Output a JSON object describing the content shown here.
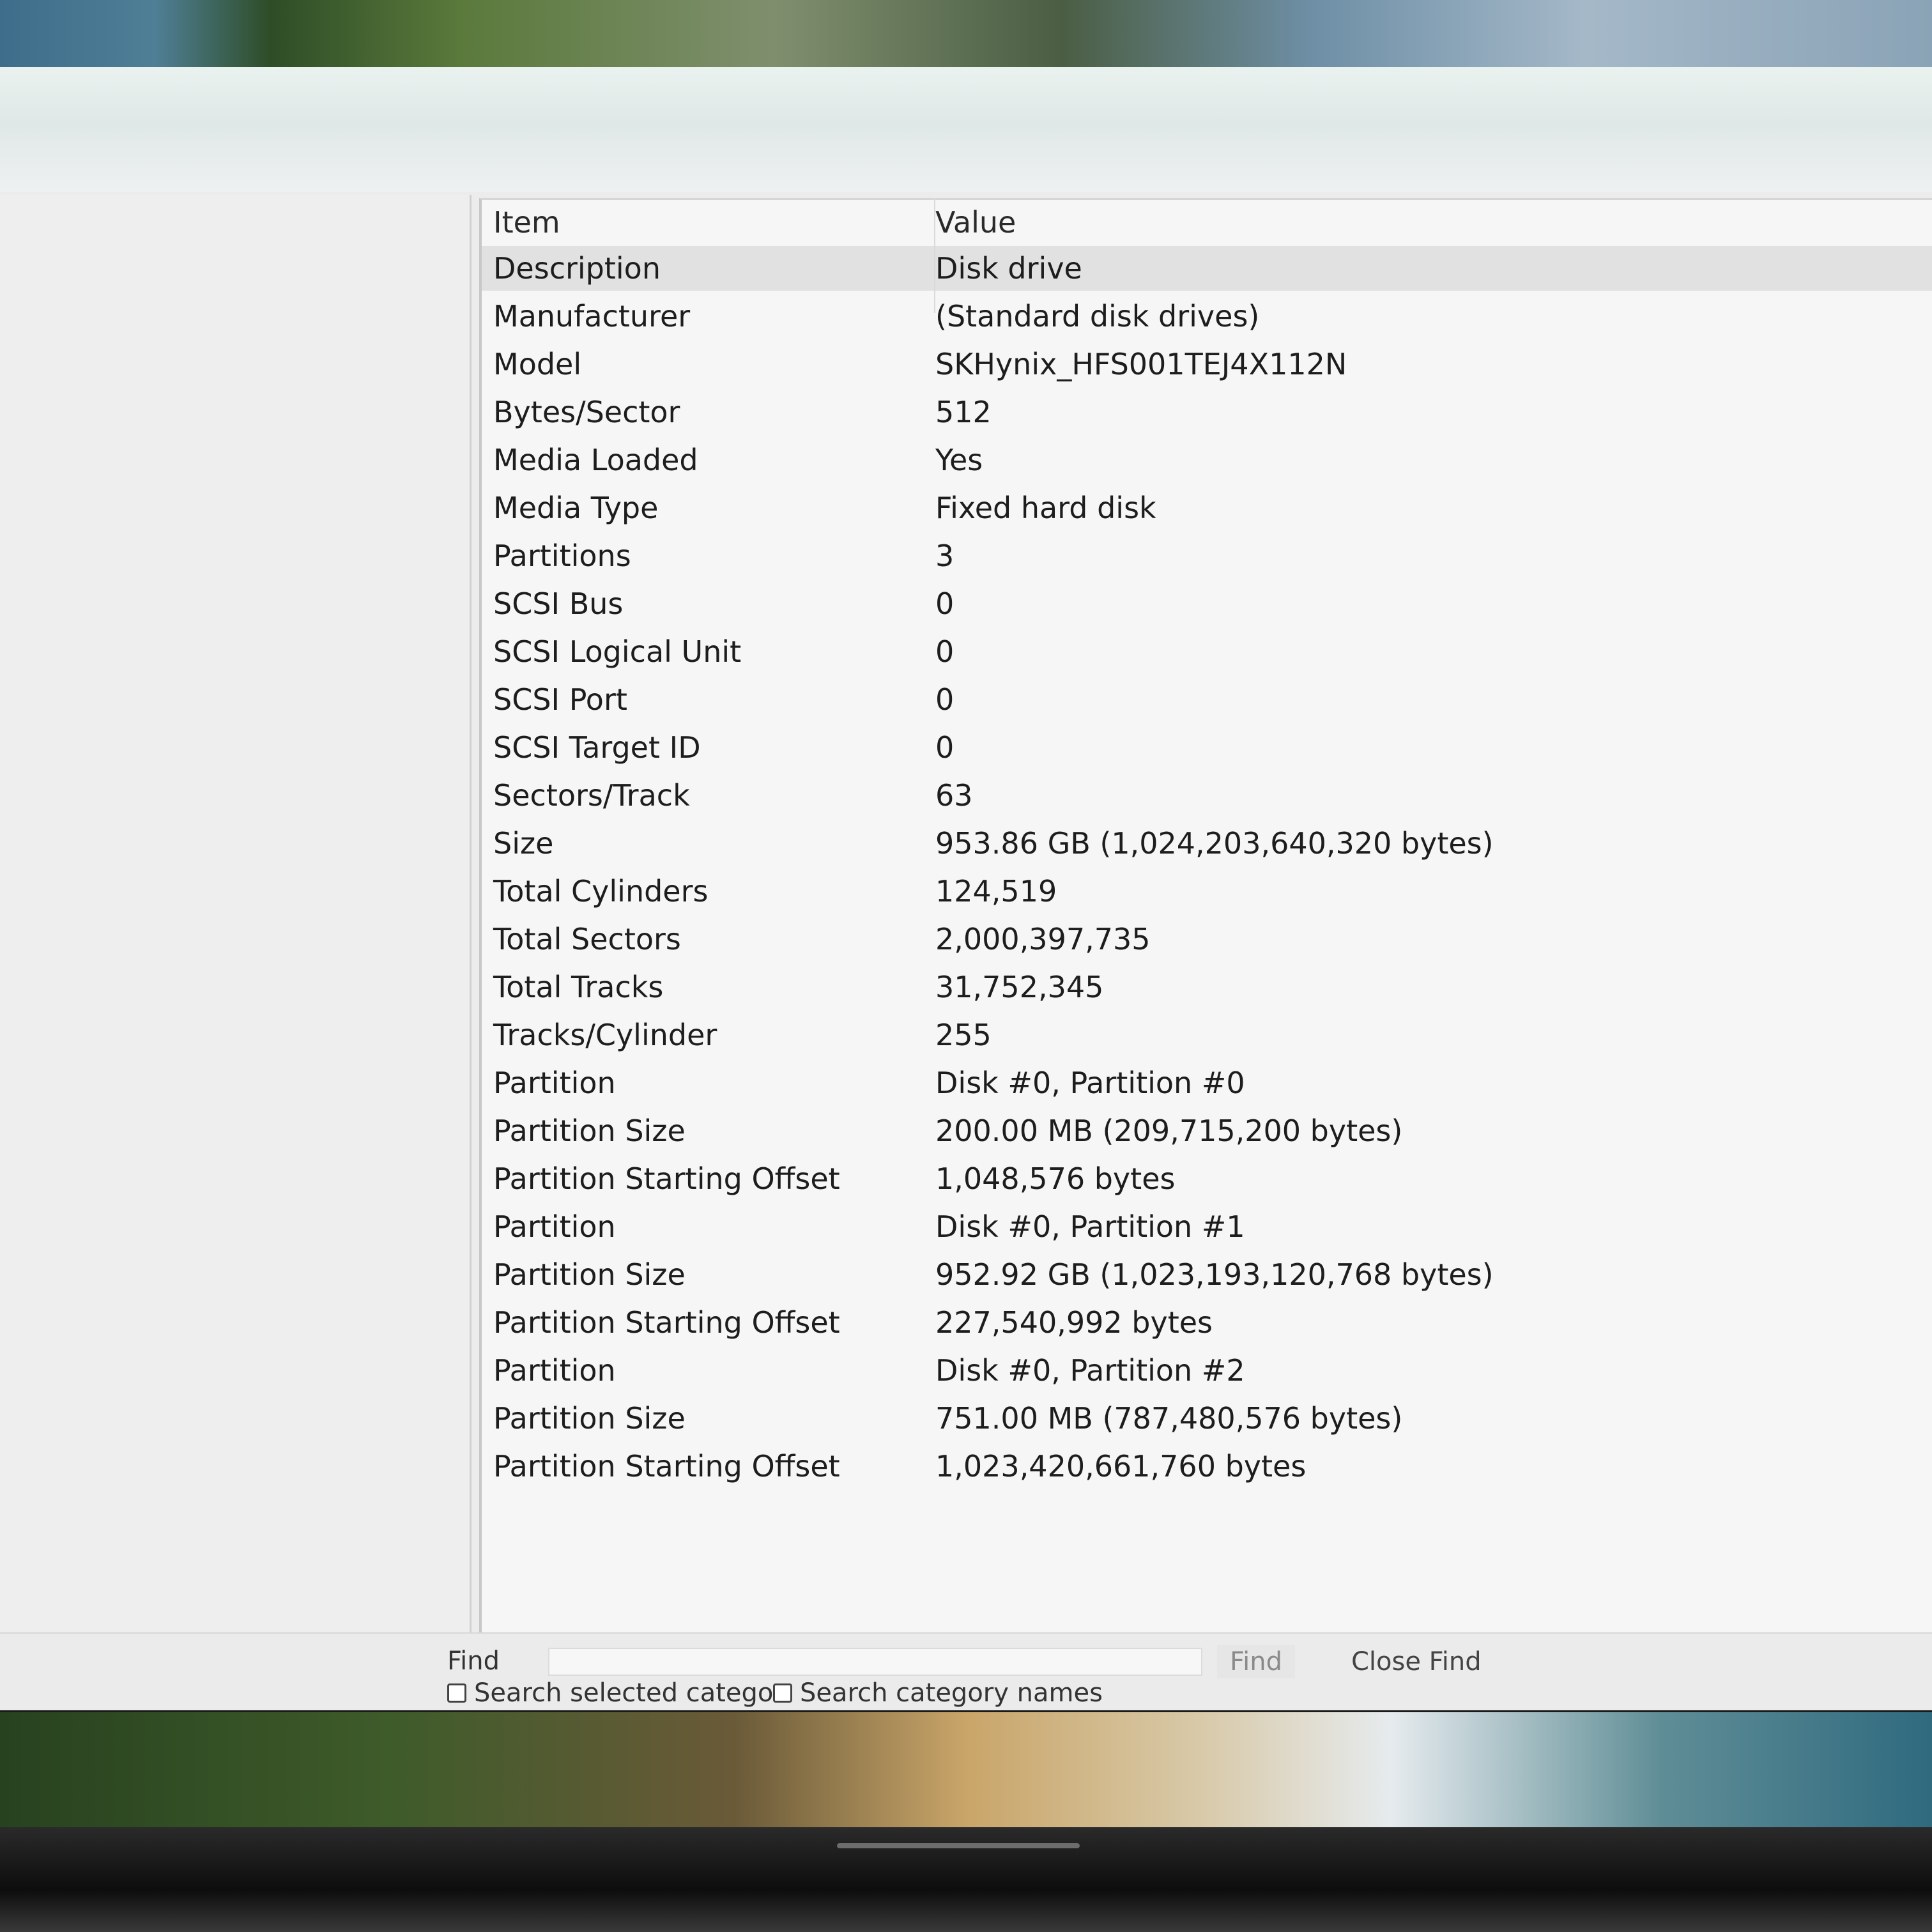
{
  "table": {
    "columns": {
      "item": "Item",
      "value": "Value"
    },
    "rows": [
      {
        "item": "Description",
        "value": "Disk drive"
      },
      {
        "item": "Manufacturer",
        "value": "(Standard disk drives)"
      },
      {
        "item": "Model",
        "value": "SKHynix_HFS001TEJ4X112N"
      },
      {
        "item": "Bytes/Sector",
        "value": "512"
      },
      {
        "item": "Media Loaded",
        "value": "Yes"
      },
      {
        "item": "Media Type",
        "value": "Fixed hard disk"
      },
      {
        "item": "Partitions",
        "value": "3"
      },
      {
        "item": "SCSI Bus",
        "value": "0"
      },
      {
        "item": "SCSI Logical Unit",
        "value": "0"
      },
      {
        "item": "SCSI Port",
        "value": "0"
      },
      {
        "item": "SCSI Target ID",
        "value": "0"
      },
      {
        "item": "Sectors/Track",
        "value": "63"
      },
      {
        "item": "Size",
        "value": "953.86 GB (1,024,203,640,320 bytes)"
      },
      {
        "item": "Total Cylinders",
        "value": "124,519"
      },
      {
        "item": "Total Sectors",
        "value": "2,000,397,735"
      },
      {
        "item": "Total Tracks",
        "value": "31,752,345"
      },
      {
        "item": "Tracks/Cylinder",
        "value": "255"
      },
      {
        "item": "Partition",
        "value": "Disk #0, Partition #0"
      },
      {
        "item": "Partition Size",
        "value": "200.00 MB (209,715,200 bytes)"
      },
      {
        "item": "Partition Starting Offset",
        "value": "1,048,576 bytes"
      },
      {
        "item": "Partition",
        "value": "Disk #0, Partition #1"
      },
      {
        "item": "Partition Size",
        "value": "952.92 GB (1,023,193,120,768 bytes)"
      },
      {
        "item": "Partition Starting Offset",
        "value": "227,540,992 bytes"
      },
      {
        "item": "Partition",
        "value": "Disk #0, Partition #2"
      },
      {
        "item": "Partition Size",
        "value": "751.00 MB (787,480,576 bytes)"
      },
      {
        "item": "Partition Starting Offset",
        "value": "1,023,420,661,760 bytes"
      }
    ]
  },
  "find_bar": {
    "label": "Find",
    "input_value": "",
    "find_button": "Find",
    "close_find_button": "Close Find",
    "search_selected_category": "Search selected categor",
    "search_category_names": "Search category names"
  }
}
